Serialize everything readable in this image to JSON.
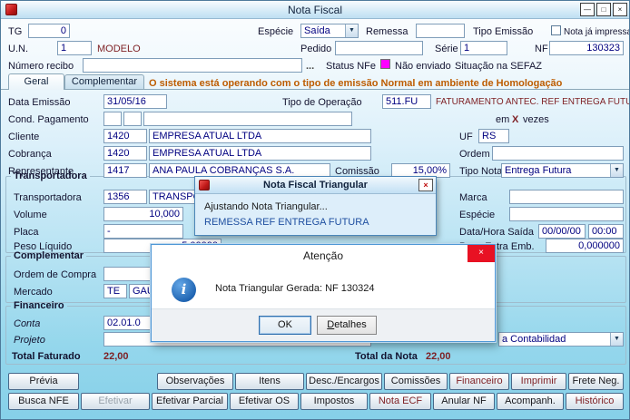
{
  "window": {
    "title": "Nota Fiscal"
  },
  "icons": {
    "minimize": "—",
    "maximize": "□",
    "close": "×",
    "dropdown_arrow": "▼",
    "info": "i"
  },
  "colors": {
    "status_nfe_square": "#ff00ff",
    "accent_text": "#7e1f23",
    "warning_text": "#bd5c00",
    "dialog_close_red": "#e81123"
  },
  "header": {
    "tg_label": "TG",
    "tg_value": "0",
    "especie_label": "Espécie",
    "especie_value": "Saída",
    "remessa_label": "Remessa",
    "remessa_value": "",
    "tipo_emissao_label": "Tipo Emissão",
    "nota_ja_impressa_label": "Nota já impressa",
    "un_label": "U.N.",
    "un_value": "1",
    "modelo_label": "MODELO",
    "pedido_label": "Pedido",
    "pedido_value": "",
    "serie_label": "Série",
    "serie_value": "1",
    "nf_label": "NF",
    "nf_value": "130323",
    "numero_recibo_label": "Número recibo",
    "numero_recibo_value": "",
    "recibo_browse_label": "...",
    "status_nfe_label": "Status NFe",
    "status_nfe_value": "Não enviado",
    "situacao_sefaz_label": "Situação na SEFAZ"
  },
  "tabs": {
    "geral": "Geral",
    "complementar": "Complementar",
    "ambiente_message": "O sistema está operando com o tipo de emissão Normal em ambiente de Homologação"
  },
  "geral": {
    "data_emissao_label": "Data Emissão",
    "data_emissao_value": "31/05/16",
    "tipo_operacao_label": "Tipo de Operação",
    "tipo_operacao_value": "511.FU",
    "tipo_operacao_desc": "FATURAMENTO ANTEC. REF ENTREGA FUTURA",
    "cond_pagamento_label": "Cond. Pagamento",
    "cond_pagamento_v1": "",
    "cond_pagamento_v2": "",
    "cond_pagamento_v3": "",
    "em_label": "em",
    "vezes_x": "X",
    "vezes_label": "vezes",
    "cliente_label": "Cliente",
    "cliente_code": "1420",
    "cliente_nome": "EMPRESA ATUAL LTDA",
    "uf_label": "UF",
    "uf_value": "RS",
    "cobranca_label": "Cobrança",
    "cobranca_code": "1420",
    "cobranca_nome": "EMPRESA ATUAL LTDA",
    "ordem_label": "Ordem",
    "ordem_value": "",
    "representante_label": "Representante",
    "representante_code": "1417",
    "representante_nome": "ANA PAULA COBRANÇAS S.A.",
    "comissao_label": "Comissão",
    "comissao_value": "15,00%",
    "tipo_nota_label": "Tipo Nota",
    "tipo_nota_value": "Entrega Futura"
  },
  "transportadora": {
    "legend": "Transportadora",
    "transportadora_label": "Transportadora",
    "transportadora_code": "1356",
    "transportadora_nome": "TRANSPORTA",
    "marca_label": "Marca",
    "marca_value": "",
    "volume_label": "Volume",
    "volume_value": "10,000",
    "especie_label": "Espécie",
    "especie_value": "",
    "placa_label": "Placa",
    "placa_value": "-",
    "data_hora_saida_label": "Data/Hora Saída",
    "data_saida_value": "00/00/00",
    "hora_saida_value": "00:00",
    "peso_liquido_label": "Peso Líquido",
    "peso_liquido_value": "5,00000",
    "peso_extra_label": "Peso Extra Emb.",
    "peso_extra_value": "0,000000"
  },
  "complementar": {
    "legend": "Complementar",
    "ordem_compra_label": "Ordem de Compra",
    "ordem_compra_value": "",
    "mercado_label": "Mercado",
    "mercado_code": "TE",
    "mercado_nome": "GAÚ"
  },
  "financeiro": {
    "legend": "Financeiro",
    "conta_label": "Conta",
    "conta_value": "02.01.0",
    "projeto_label": "Projeto",
    "projeto_value": "",
    "contabilidade_value": "a Contabilidad",
    "total_faturado_label": "Total Faturado",
    "total_faturado_value": "22,00",
    "total_nota_label": "Total da Nota",
    "total_nota_value": "22,00"
  },
  "dialog_triangular": {
    "title": "Nota Fiscal Triangular",
    "line1": "Ajustando Nota Triangular...",
    "line2": "REMESSA REF ENTREGA FUTURA"
  },
  "dialog_atencao": {
    "title": "Atenção",
    "message": "Nota Triangular Gerada: NF 130324",
    "ok_label": "OK",
    "detalhes_label": "Detalhes"
  },
  "buttons": {
    "row1": [
      {
        "label": "Prévia"
      },
      {
        "label": "Observações"
      },
      {
        "label": "Itens"
      },
      {
        "label": "Desc./Encargos"
      },
      {
        "label": "Comissões"
      },
      {
        "label": "Financeiro"
      },
      {
        "label": "Imprimir"
      },
      {
        "label": "Frete Neg."
      }
    ],
    "row2": [
      {
        "label": "Busca NFE"
      },
      {
        "label": "Efetivar"
      },
      {
        "label": "Efetivar Parcial"
      },
      {
        "label": "Efetivar OS"
      },
      {
        "label": "Impostos"
      },
      {
        "label": "Nota ECF"
      },
      {
        "label": "Anular NF"
      },
      {
        "label": "Acompanh."
      },
      {
        "label": "Histórico"
      }
    ]
  }
}
